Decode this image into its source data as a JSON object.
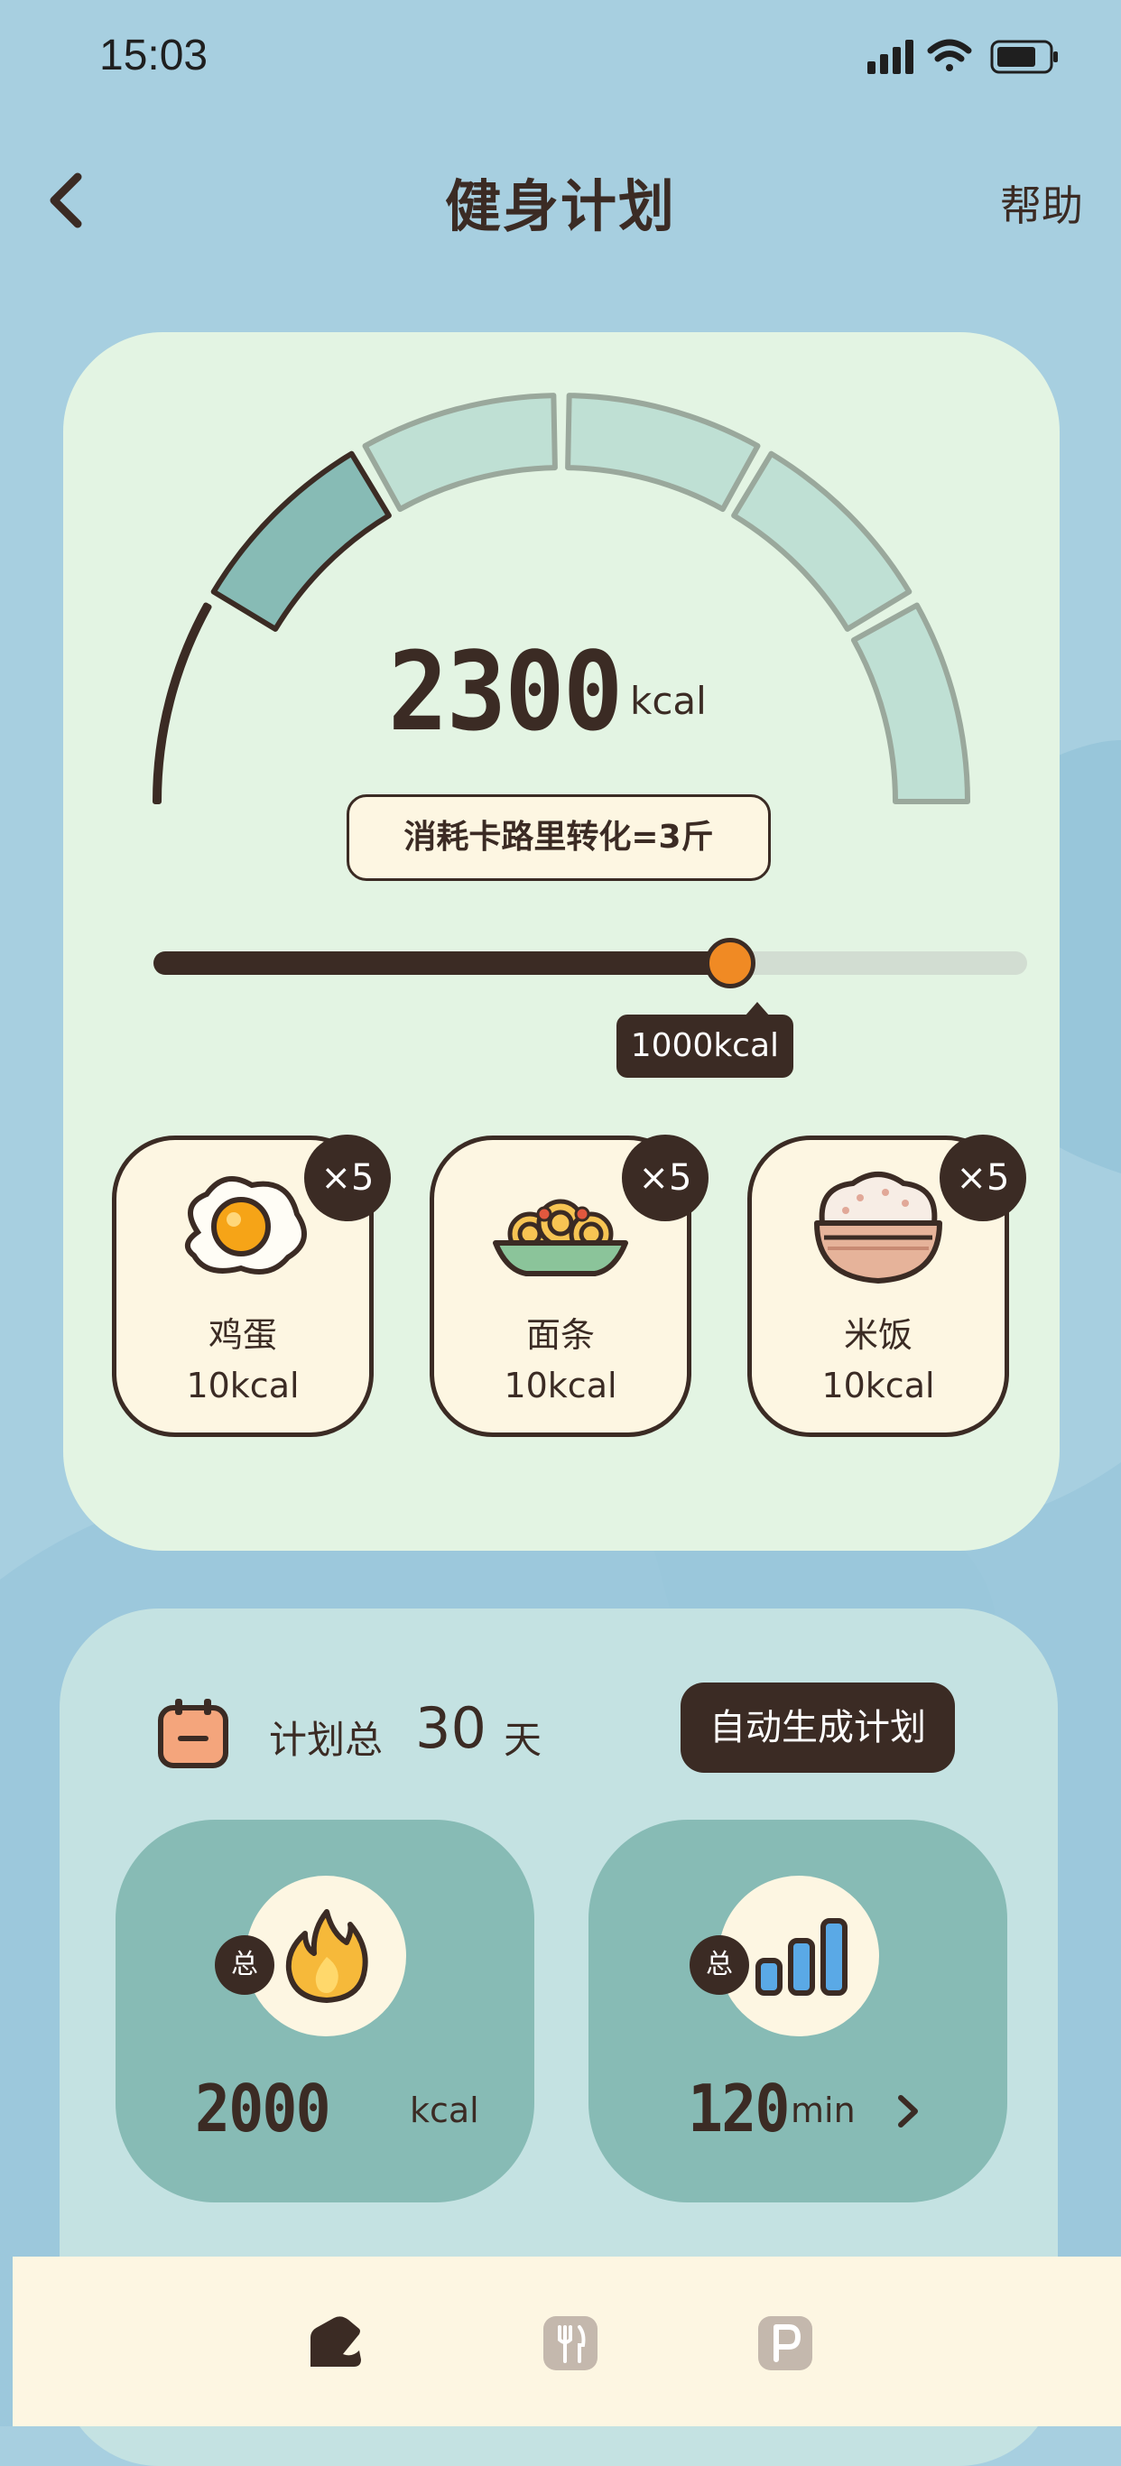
{
  "status_bar": {
    "time": "15:03"
  },
  "header": {
    "title": "健身计划",
    "help_label": "帮助"
  },
  "calorie_card": {
    "gauge_value": "2300",
    "gauge_unit": "kcal",
    "gauge_filled_segments": 2,
    "gauge_total_segments": 6,
    "conversion_text": "消耗卡路里转化=3斤",
    "slider": {
      "fraction": 0.66,
      "tooltip": "1000kcal"
    },
    "foods": [
      {
        "name": "鸡蛋",
        "kcal": "10kcal",
        "count": "×5",
        "icon": "egg-icon"
      },
      {
        "name": "面条",
        "kcal": "10kcal",
        "count": "×5",
        "icon": "noodles-icon"
      },
      {
        "name": "米饭",
        "kcal": "10kcal",
        "count": "×5",
        "icon": "rice-icon"
      }
    ]
  },
  "plan": {
    "prefix": "计划总",
    "days": "30",
    "suffix": "天",
    "auto_button": "自动生成计划",
    "stats": [
      {
        "badge": "总",
        "value": "2000",
        "unit": "kcal",
        "icon": "fire-icon"
      },
      {
        "badge": "总",
        "value": "120",
        "unit": "min",
        "icon": "bars-icon"
      }
    ]
  },
  "tabbar": {
    "tabs": [
      "home-icon",
      "meal-icon",
      "parking-icon"
    ],
    "active": 0
  },
  "colors": {
    "background": "#a7cfe0",
    "card": "#e3f4e3",
    "dark": "#3b2b24",
    "accent": "#f08a24",
    "teal": "#87bbb5",
    "cream": "#fdf6e2"
  }
}
